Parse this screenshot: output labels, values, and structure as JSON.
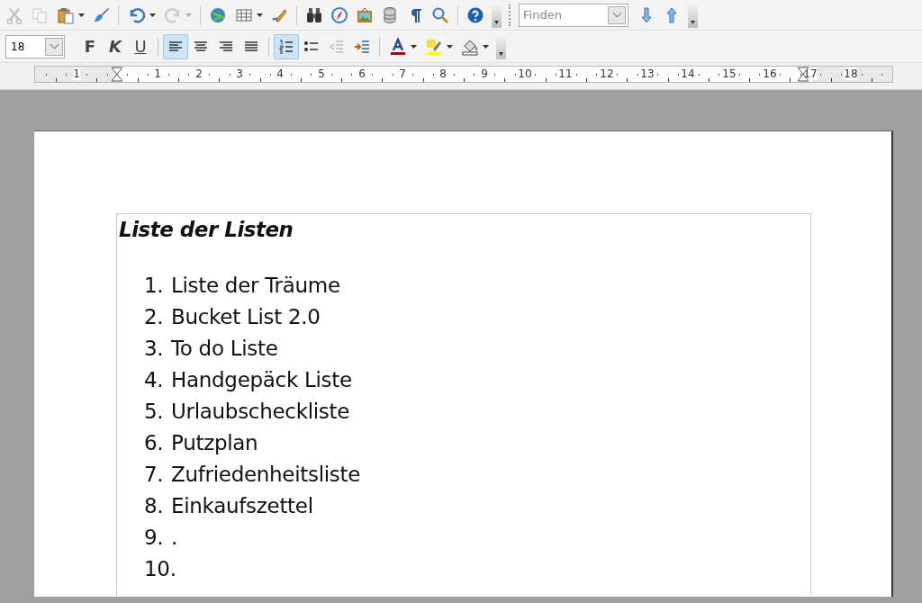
{
  "standard_toolbar": {
    "tools": [
      {
        "kind": "cut",
        "disabled": true,
        "has_menu": false
      },
      {
        "kind": "copy",
        "disabled": true,
        "has_menu": false
      },
      {
        "kind": "paste",
        "disabled": false,
        "has_menu": true
      },
      {
        "kind": "brush",
        "disabled": false,
        "has_menu": false
      },
      {
        "kind": "separator"
      },
      {
        "kind": "undo",
        "disabled": false,
        "has_menu": true
      },
      {
        "kind": "redo",
        "disabled": true,
        "has_menu": true
      },
      {
        "kind": "separator"
      },
      {
        "kind": "globe",
        "disabled": false,
        "has_menu": false
      },
      {
        "kind": "table",
        "disabled": false,
        "has_menu": true
      },
      {
        "kind": "pencil",
        "disabled": false,
        "has_menu": false
      },
      {
        "kind": "separator"
      },
      {
        "kind": "binoculars",
        "disabled": false,
        "has_menu": false
      },
      {
        "kind": "compass",
        "disabled": false,
        "has_menu": false
      },
      {
        "kind": "image",
        "disabled": false,
        "has_menu": false
      },
      {
        "kind": "database",
        "disabled": false,
        "has_menu": false
      },
      {
        "kind": "pilcrow",
        "disabled": false,
        "has_menu": false
      },
      {
        "kind": "zoom",
        "disabled": false,
        "has_menu": false
      },
      {
        "kind": "separator"
      },
      {
        "kind": "help",
        "disabled": false,
        "has_menu": false
      }
    ]
  },
  "find_toolbar": {
    "find_field": {
      "placeholder": "Finden"
    },
    "tools": [
      {
        "kind": "arrow-down"
      },
      {
        "kind": "arrow-up"
      }
    ]
  },
  "formatting_toolbar": {
    "font_size": "18",
    "style_buttons": [
      {
        "label": "F",
        "kind": "bold"
      },
      {
        "label": "K",
        "kind": "italic"
      },
      {
        "label": "U",
        "kind": "underline"
      }
    ],
    "tools": [
      {
        "kind": "separator"
      },
      {
        "kind": "align-left",
        "selected": true,
        "disabled": false,
        "has_menu": false
      },
      {
        "kind": "align-center",
        "selected": false,
        "disabled": false,
        "has_menu": false
      },
      {
        "kind": "align-right",
        "selected": false,
        "disabled": false,
        "has_menu": false
      },
      {
        "kind": "justify",
        "selected": false,
        "disabled": false,
        "has_menu": false
      },
      {
        "kind": "separator"
      },
      {
        "kind": "numbered-list",
        "selected": true,
        "disabled": false,
        "has_menu": false
      },
      {
        "kind": "bullet-list",
        "selected": false,
        "disabled": false,
        "has_menu": false
      },
      {
        "kind": "outdent",
        "selected": false,
        "disabled": true,
        "has_menu": false
      },
      {
        "kind": "indent",
        "selected": false,
        "disabled": false,
        "has_menu": false
      },
      {
        "kind": "separator"
      },
      {
        "kind": "font-color",
        "selected": false,
        "disabled": false,
        "has_menu": true
      },
      {
        "kind": "highlight",
        "selected": false,
        "disabled": false,
        "has_menu": true
      },
      {
        "kind": "shading",
        "selected": false,
        "disabled": false,
        "has_menu": true
      }
    ]
  },
  "ruler": {
    "labels": [
      "1",
      "1",
      "2",
      "3",
      "4",
      "5",
      "6",
      "7",
      "8",
      "9",
      "10",
      "11",
      "12",
      "13",
      "14",
      "15",
      "16",
      "17",
      "18"
    ]
  },
  "document": {
    "title": "Liste der Listen",
    "items": [
      {
        "number": "1.",
        "text": "Liste der Träume"
      },
      {
        "number": "2.",
        "text": "Bucket List 2.0"
      },
      {
        "number": "3.",
        "text": "To do Liste"
      },
      {
        "number": "4.",
        "text": "Handgepäck Liste"
      },
      {
        "number": "5.",
        "text": "Urlaubscheckliste"
      },
      {
        "number": "6.",
        "text": "Putzplan"
      },
      {
        "number": "7.",
        "text": "Zufriedenheitsliste"
      },
      {
        "number": "8.",
        "text": "Einkaufszettel"
      },
      {
        "number": "9.",
        "text": "."
      },
      {
        "number": "10."
      }
    ]
  }
}
